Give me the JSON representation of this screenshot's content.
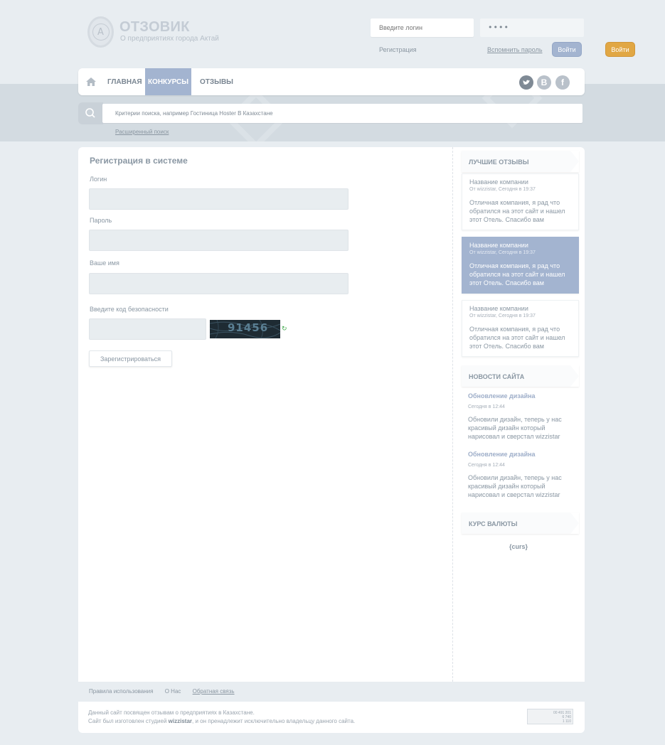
{
  "header": {
    "logo_letter": "A",
    "site_title": "ОТЗОВИК",
    "site_subtitle": "О предприятиях города Актай",
    "login_placeholder": "Введите логин",
    "password_value": "••••",
    "register_link": "Регистрация",
    "remember_link": "Вспомнить пароль",
    "login_button": "Войти",
    "login_button_alt": "Войти"
  },
  "nav": {
    "items": [
      {
        "label": "ГЛАВНАЯ"
      },
      {
        "label": "КОНКУРСЫ"
      },
      {
        "label": "ОТЗЫВЫ"
      }
    ],
    "social": [
      "twitter-icon",
      "vk-icon",
      "facebook-icon"
    ],
    "social_labels": {
      "vk": "В",
      "fb": "f"
    }
  },
  "search": {
    "placeholder": "Критерии поиска, например Гостиница Hoster В Казахстане",
    "advanced_link": "Расширенный поиск"
  },
  "form": {
    "title": "Регистрация в системе",
    "login_label": "Логин",
    "password_label": "Пароль",
    "name_label": "Ваше имя",
    "captcha_label": "Введите код безопасности",
    "captcha_code": "91456",
    "submit_label": "Зарегистрироваться"
  },
  "sidebar": {
    "best_reviews_title": "ЛУЧШИЕ ОТЗЫВЫ",
    "reviews": [
      {
        "company": "Название компании",
        "meta": "От wizzistar, Сегодня в 19:37",
        "text": "Отличная компания, я рад что обратился на этот сайт и нашел этот Отель. Спасибо вам"
      },
      {
        "company": "Название компании",
        "meta": "От wizzistar, Сегодня в 19:37",
        "text": "Отличная компания, я рад что обратился на этот сайт и нашел этот Отель. Спасибо вам"
      },
      {
        "company": "Название компании",
        "meta": "От wizzistar, Сегодня в 19:37",
        "text": "Отличная компания, я рад что обратился на этот сайт и нашел этот Отель. Спасибо вам"
      }
    ],
    "news_title": "НОВОСТИ САЙТА",
    "news": [
      {
        "title": "Обновление дизайна",
        "date": "Сегодня в 12:44",
        "text": "Обновили дизайн, теперь у нас красивый дизайн который нарисовал и сверстал wizzistar"
      },
      {
        "title": "Обновление дизайна",
        "date": "Сегодня в 12:44",
        "text": "Обновили дизайн, теперь у нас красивый дизайн который нарисовал и сверстал wizzistar"
      }
    ],
    "currency_title": "КУРС ВАЛЮТЫ",
    "currency_placeholder": "{curs}"
  },
  "footer": {
    "links": [
      "Правила использования",
      "О Нас",
      "Обратная связь"
    ],
    "line1": "Данный сайт посвящен отзывам о предприятиях в Казахстане.",
    "line2_pre": "Сайт был изготовлен студией ",
    "line2_brand": "wizzistar",
    "line2_post": ", и он пренадлежит исключительно владельцу данного сайта.",
    "counter_lines": [
      "00 491 201",
      "6 740",
      "1 110"
    ]
  },
  "colors": {
    "accent_blue": "#a3b4d0",
    "accent_orange": "#e1a744",
    "background": "#e8edf1"
  }
}
